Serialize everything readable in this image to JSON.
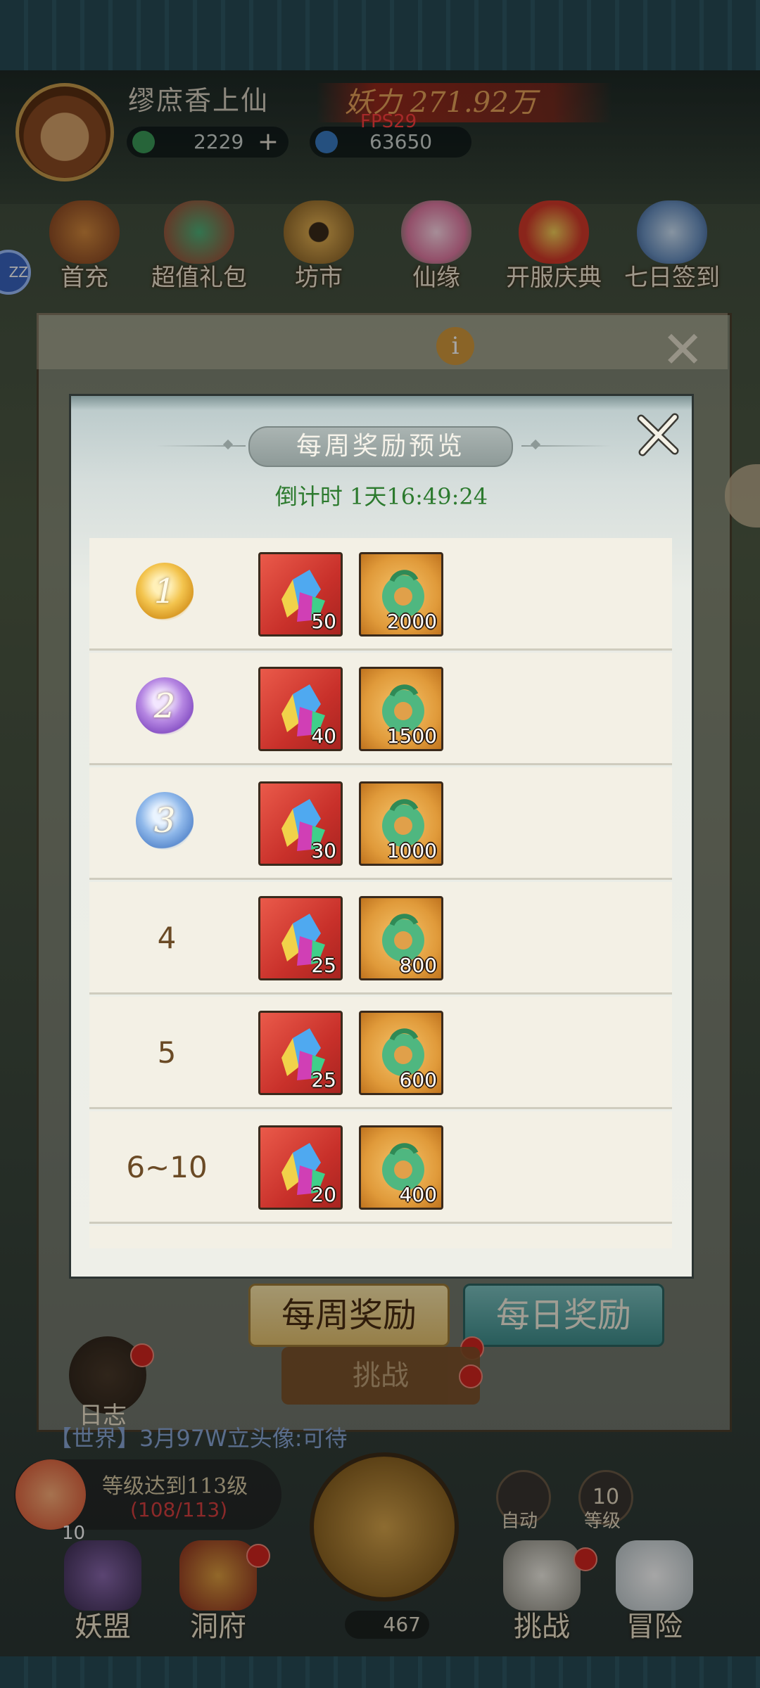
{
  "header": {
    "player_name": "缪庶香上仙",
    "currency_coin": "2229",
    "plus": "+",
    "currency_crystal": "63650",
    "power_label": "妖力 271.92万",
    "fps": "FPS29"
  },
  "menu": [
    {
      "label": "首充",
      "icon": "gift-bag-icon"
    },
    {
      "label": "超值礼包",
      "icon": "treasure-bag-icon"
    },
    {
      "label": "坊市",
      "icon": "coin-icon"
    },
    {
      "label": "仙缘",
      "icon": "lotus-icon"
    },
    {
      "label": "开服庆典",
      "icon": "present-box-icon"
    },
    {
      "label": "七日签到",
      "icon": "clock-icon"
    }
  ],
  "left_badge": "ZZ",
  "underlying": {
    "info": "i",
    "tab_weekly": "每周奖励",
    "tab_daily": "每日奖励",
    "challenge": "挑战",
    "log": "日志",
    "chat": "【世界】3月97W立头像:可待"
  },
  "bottom": {
    "task_text": "等级达到113级",
    "task_progress": "(108/113)",
    "task_number": "10",
    "auto_label": "自动",
    "level_value": "10",
    "level_label": "等级",
    "food_count": "467",
    "nav": [
      {
        "label": "妖盟"
      },
      {
        "label": "洞府"
      },
      {
        "label": "挑战"
      },
      {
        "label": "冒险"
      }
    ]
  },
  "modal": {
    "title": "每周奖励预览",
    "countdown": "倒计时 1天16:49:24",
    "rows": [
      {
        "rank": "1",
        "medal": "gold",
        "gem": "50",
        "jade": "2000"
      },
      {
        "rank": "2",
        "medal": "purple",
        "gem": "40",
        "jade": "1500"
      },
      {
        "rank": "3",
        "medal": "blue",
        "gem": "30",
        "jade": "1000"
      },
      {
        "rank": "4",
        "medal": "",
        "gem": "25",
        "jade": "800"
      },
      {
        "rank": "5",
        "medal": "",
        "gem": "25",
        "jade": "600"
      },
      {
        "rank": "6~10",
        "medal": "",
        "gem": "20",
        "jade": "400"
      }
    ]
  }
}
